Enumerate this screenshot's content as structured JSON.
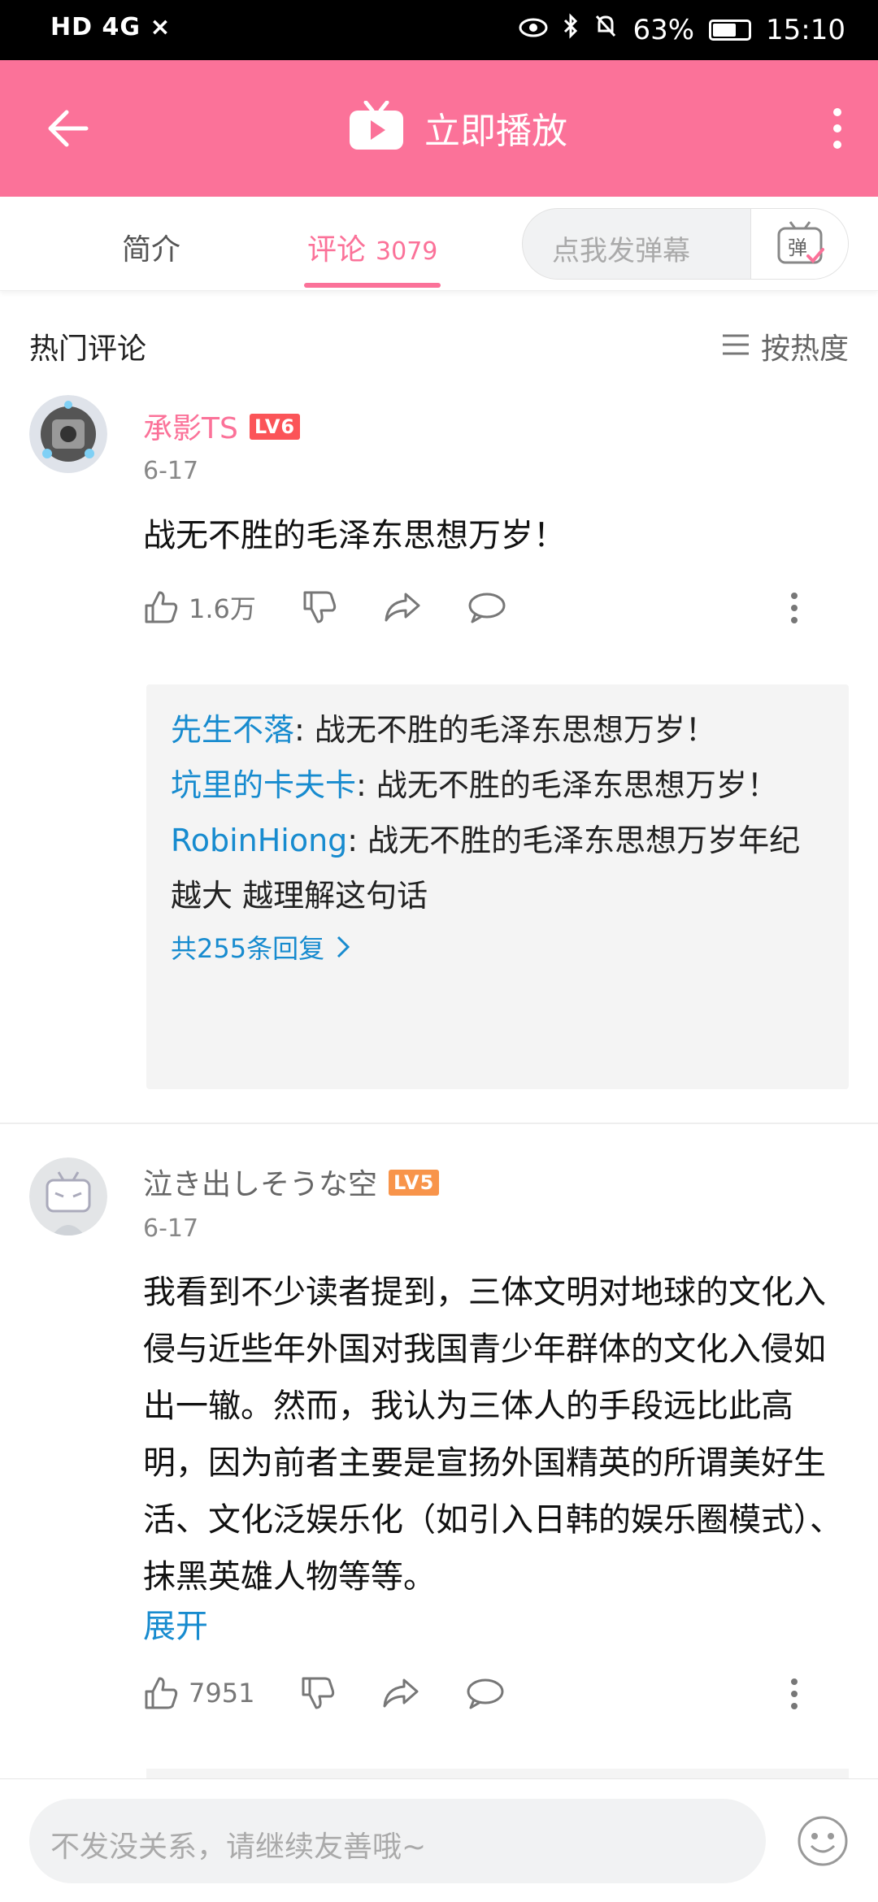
{
  "status_bar": {
    "left": "HD 4G ×",
    "battery": "63%",
    "time": "15:10"
  },
  "top_bar": {
    "title": "立即播放",
    "back_icon": "back-arrow-icon",
    "menu_icon": "more-vertical-icon"
  },
  "tabs": {
    "intro": "简介",
    "comments": "评论",
    "comments_count": "3079",
    "danmaku_placeholder": "点我发弹幕",
    "danmaku_btn_text": "弹"
  },
  "comments_header": {
    "title": "热门评论",
    "sort_label": "按热度"
  },
  "comments": [
    {
      "username": "承影TS",
      "level": "LV6",
      "date": "6-17",
      "text": "战无不胜的毛泽东思想万岁！",
      "likes": "1.6万",
      "replies": [
        {
          "name": "先生不落",
          "text": ": 战无不胜的毛泽东思想万岁！"
        },
        {
          "name": "坑里的卡夫卡",
          "text": ": 战无不胜的毛泽东思想万岁！"
        },
        {
          "name": "RobinHiong",
          "text": ": 战无不胜的毛泽东思想万岁年纪越大 越理解这句话"
        }
      ],
      "more_replies": "共255条回复"
    },
    {
      "username": "泣き出しそうな空",
      "level": "LV5",
      "date": "6-17",
      "text": "我看到不少读者提到，三体文明对地球的文化入侵与近些年外国对我国青少年群体的文化入侵如出一辙。然而，我认为三体人的手段远比此高明，因为前者主要是宣扬外国精英的所谓美好生活、文化泛娱乐化（如引入日韩的娱乐圈模式）、抹黑英雄人物等等。",
      "expand": "展开",
      "likes": "7951"
    }
  ],
  "bottom_bar": {
    "placeholder": "不发没关系，请继续友善哦~"
  },
  "colors": {
    "accent": "#fb7299",
    "link": "#178bcf",
    "lv6": "#fb5458",
    "lv5": "#f8944a"
  }
}
